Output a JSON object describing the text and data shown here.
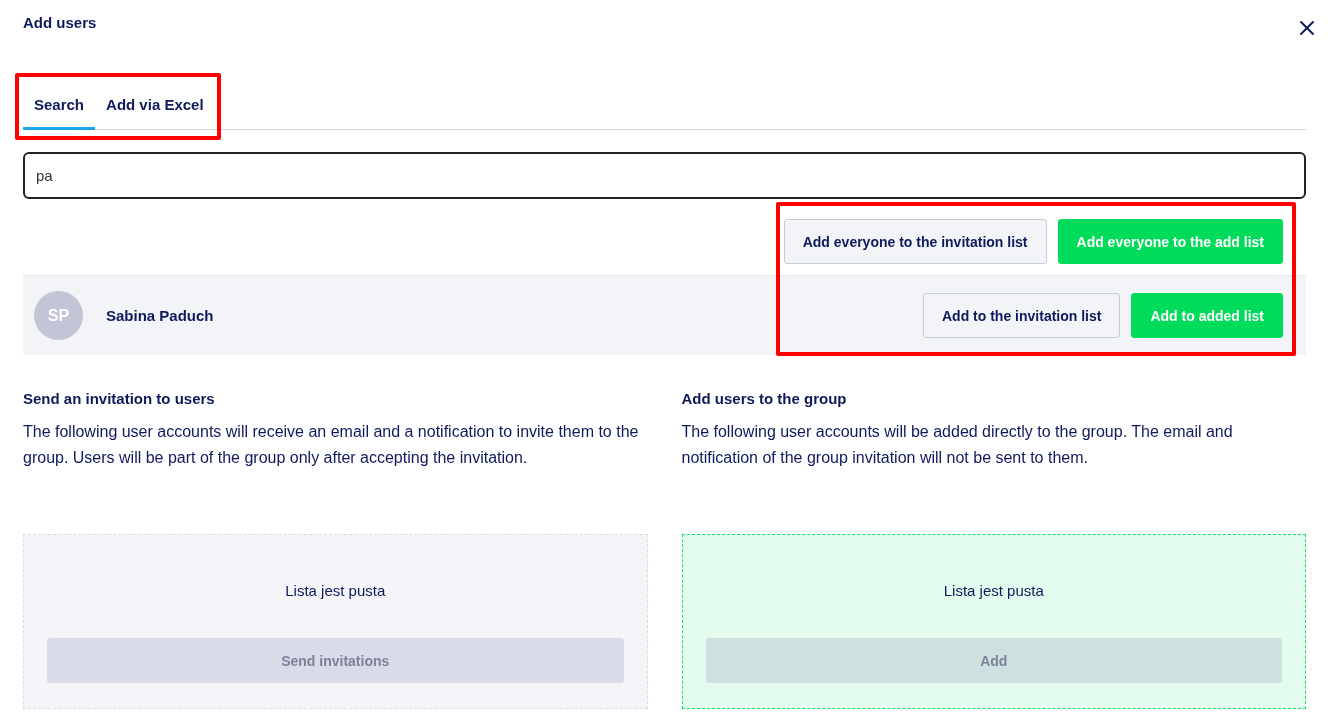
{
  "dialog": {
    "title": "Add users"
  },
  "tabs": [
    {
      "label": "Search",
      "selected": true
    },
    {
      "label": "Add via Excel",
      "selected": false
    }
  ],
  "search": {
    "value": "pa"
  },
  "bulk_actions": [
    {
      "label": "Add everyone to the invitation list",
      "kind": "secondary"
    },
    {
      "label": "Add everyone to the add list",
      "kind": "primary"
    }
  ],
  "results": [
    {
      "initials": "SP",
      "name": "Sabina Paduch",
      "actions": [
        {
          "label": "Add to the invitation list",
          "kind": "secondary"
        },
        {
          "label": "Add to added list",
          "kind": "primary"
        }
      ]
    }
  ],
  "columns": [
    {
      "kind": "invite",
      "heading": "Send an invitation to users",
      "description": "The following user accounts will receive an email and a notification to invite them to the group. Users will be part of the group only after accepting the invitation.",
      "empty_text": "Lista jest pusta",
      "button": {
        "label": "Send invitations",
        "disabled": true
      }
    },
    {
      "kind": "add",
      "heading": "Add users to the group",
      "description": "The following user accounts will be added directly to the group. The email and notification of the group invitation will not be sent to them.",
      "empty_text": "Lista jest pusta",
      "button": {
        "label": "Add",
        "disabled": true
      }
    }
  ]
}
